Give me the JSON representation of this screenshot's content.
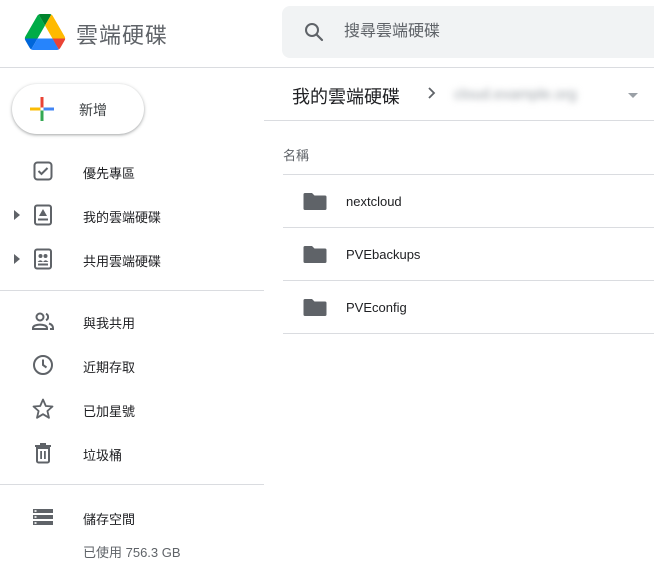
{
  "app": {
    "title": "雲端硬碟",
    "logo_icon": "google-drive-logo"
  },
  "search": {
    "placeholder": "搜尋雲端硬碟",
    "value": "",
    "icon": "search-icon"
  },
  "sidebar": {
    "new_button_label": "新增",
    "items": [
      {
        "label": "優先專區",
        "icon": "priority-checkbox-icon",
        "expandable": false
      },
      {
        "label": "我的雲端硬碟",
        "icon": "my-drive-icon",
        "expandable": true
      },
      {
        "label": "共用雲端硬碟",
        "icon": "shared-drives-icon",
        "expandable": true
      },
      {
        "label": "與我共用",
        "icon": "people-icon",
        "expandable": false
      },
      {
        "label": "近期存取",
        "icon": "clock-icon",
        "expandable": false
      },
      {
        "label": "已加星號",
        "icon": "star-icon",
        "expandable": false
      },
      {
        "label": "垃圾桶",
        "icon": "trash-icon",
        "expandable": false
      },
      {
        "label": "儲存空間",
        "icon": "storage-icon",
        "expandable": false
      }
    ],
    "storage_used": "已使用 756.3 GB"
  },
  "main": {
    "breadcrumb": {
      "root": "我的雲端硬碟",
      "current": "cloud.example.org"
    },
    "column_name_label": "名稱",
    "files": [
      {
        "name": "nextcloud",
        "type": "folder"
      },
      {
        "name": "PVEbackups",
        "type": "folder"
      },
      {
        "name": "PVEconfig",
        "type": "folder"
      }
    ]
  },
  "colors": {
    "accent_blue": "#4285F4",
    "accent_red": "#EA4335",
    "accent_yellow": "#FBBC04",
    "accent_green": "#34A853",
    "icon_gray": "#5f6368"
  }
}
